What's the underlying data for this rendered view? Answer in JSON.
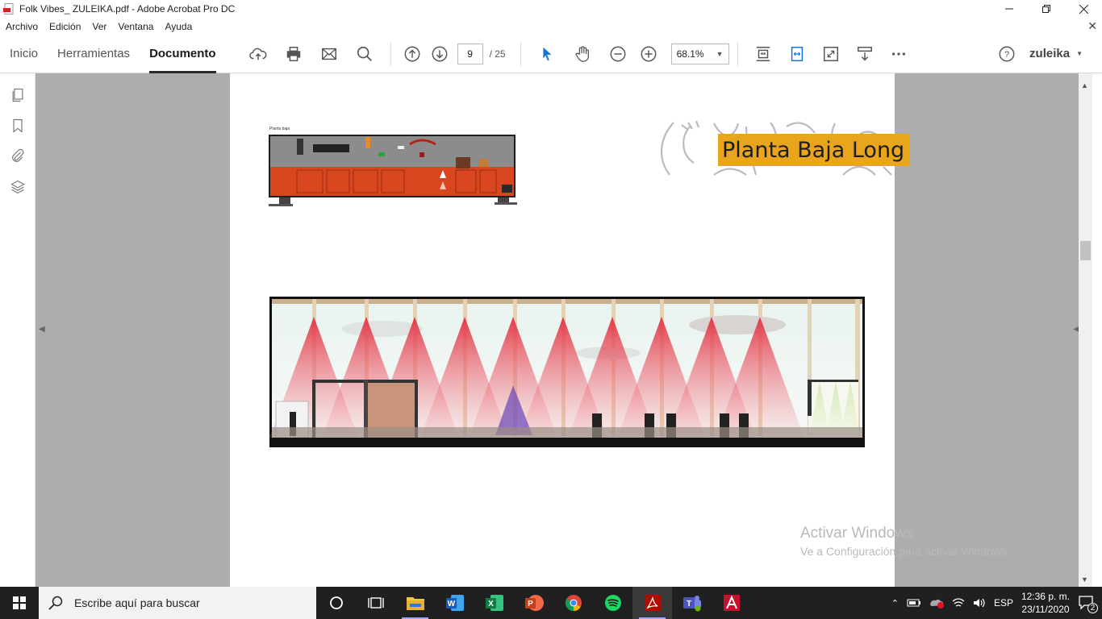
{
  "window": {
    "title": "Folk Vibes_ ZULEIKA.pdf - Adobe Acrobat Pro DC"
  },
  "menu": [
    "Archivo",
    "Edición",
    "Ver",
    "Ventana",
    "Ayuda"
  ],
  "nav_tabs": [
    "Inicio",
    "Herramientas",
    "Documento"
  ],
  "active_tab": "Documento",
  "toolbar": {
    "page_current": "9",
    "page_total": "/ 25",
    "zoom": "68.1%",
    "user": "zuleika",
    "icons": [
      "cloud-upload-icon",
      "print-icon",
      "mail-icon",
      "search-icon",
      "prev-page-icon",
      "next-page-icon",
      "select-cursor-icon",
      "hand-icon",
      "zoom-out-icon",
      "zoom-in-icon",
      "fit-page-icon",
      "fit-width-icon",
      "full-screen-icon",
      "read-mode-icon",
      "more-icon",
      "help-icon"
    ]
  },
  "document": {
    "plan_label": "Planta baja",
    "title_tag": "Planta Baja Long"
  },
  "watermark": {
    "title": "Activar Windows",
    "subtitle": "Ve a Configuración para activar Windows."
  },
  "taskbar": {
    "search_placeholder": "Escribe aquí para buscar",
    "language": "ESP",
    "time": "12:36 p. m.",
    "date": "23/11/2020",
    "notifications": "2",
    "apps": [
      "cortana",
      "task-view",
      "file-explorer",
      "word",
      "excel",
      "powerpoint",
      "chrome",
      "spotify",
      "acrobat",
      "teams",
      "autocad"
    ]
  },
  "colors": {
    "accent_tag": "#e9a51c",
    "plan_red": "#d7461f",
    "cone_red": "#e23040",
    "taskbar": "#202020"
  }
}
